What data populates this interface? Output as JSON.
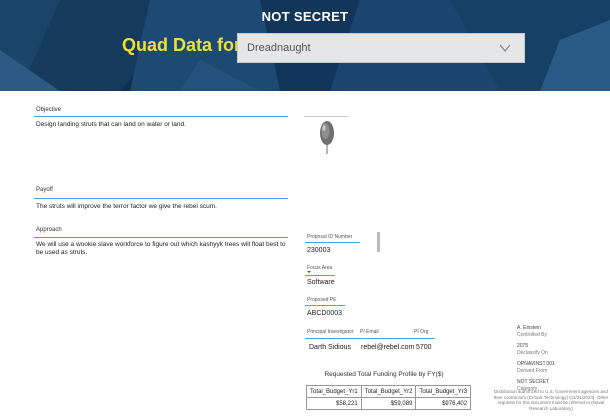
{
  "banner": {
    "classification": "NOT SECRET",
    "quad_label": "Quad Data for:",
    "selected_project": "Dreadnaught"
  },
  "objective": {
    "label": "Objective",
    "text": "Design landing struts that can land on water or land."
  },
  "payoff": {
    "label": "Payoff",
    "text": "The struts will improve the terror factor we give the rebel scum."
  },
  "approach": {
    "label": "Approach",
    "text": "We will use a wookie slave workforce to figure out which kashyyk trees will float best to be used as struts."
  },
  "proposal": {
    "id_label": "Proposal ID Number",
    "id_value": "230003",
    "focus_label": "Focus Area",
    "focus_value": "Software",
    "pe_label": "Proposed PE",
    "pe_value": "ABCD0003",
    "pi_label": "Principal Investigator",
    "pi_email_label": "PI Email",
    "pi_org_label": "PI Org",
    "pi_value": "Darth Sidious",
    "pi_email_value": "rebel@rebel.com",
    "pi_org_value": "5700"
  },
  "funding": {
    "title": "Requested Total Funding Profile by FY($)",
    "headers": [
      "Total_Budget_Yr1",
      "Total_Budget_Yr2",
      "Total_Budget_Yr3"
    ],
    "values": [
      "$58,221",
      "$59,089",
      "$976,402"
    ]
  },
  "classification_block": {
    "controlled_by_value": "A. Einstein",
    "controlled_by_label": "Controlled By",
    "declassify_value": "2075",
    "declassify_label": "Declassify On",
    "derived_value": "OPNAVINST.001",
    "derived_label": "Derived From",
    "category_value": "NOT SECRET",
    "category_label": "Category",
    "distribution": "Distribution authorized to U.S. Government agencies and their contractors (Critical Technology) (11/31/2024). Other requests for this document must be referred to (Naval Research Laboratory)"
  },
  "colors": {
    "banner": "#0f2d4a",
    "accent_yellow": "#f0e030",
    "rule_blue": "#4aa3df"
  }
}
